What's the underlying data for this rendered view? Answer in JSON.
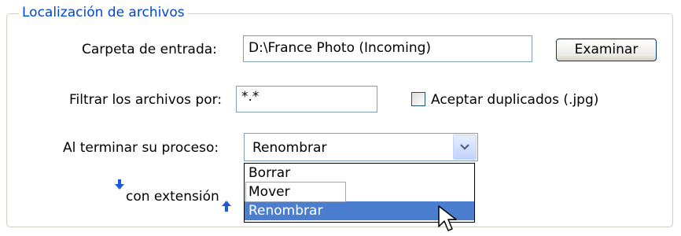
{
  "group": {
    "title": "Localización de archivos"
  },
  "input_folder": {
    "label": "Carpeta de entrada:",
    "value": "D:\\France Photo (Incoming)",
    "button": "Examinar"
  },
  "filter": {
    "label": "Filtrar los archivos por:",
    "value": "*.*"
  },
  "duplicates": {
    "label": "Aceptar duplicados (.jpg)",
    "checked": false
  },
  "on_finish": {
    "label": "Al terminar su proceso:",
    "selected": "Renombrar",
    "options": [
      "Borrar",
      "Mover",
      "Renombrar"
    ]
  },
  "extension": {
    "label": "con extensión"
  },
  "icons": {
    "combo_arrow": "chevron-down-icon",
    "cursor": "mouse-pointer-icon",
    "arrow_down": "arrow-down-icon",
    "arrow_up": "arrow-up-icon"
  },
  "colors": {
    "legend": "#0046d5",
    "selection": "#4c7ed0",
    "hint_arrow": "#1c5ad8"
  }
}
